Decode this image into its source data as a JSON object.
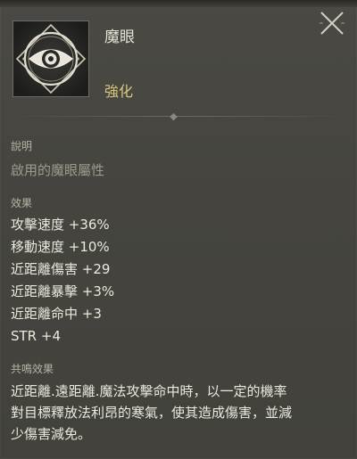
{
  "item": {
    "name": "魔眼",
    "category": "強化",
    "icon": "eye-sigil-icon"
  },
  "close_icon": "close-icon",
  "description_section": {
    "label": "說明",
    "text": "啟用的魔眼屬性"
  },
  "effects_section": {
    "label": "效果",
    "lines": [
      "攻擊速度 +36%",
      "移動速度 +10%",
      "近距離傷害 +29",
      "近距離暴擊 +3%",
      "近距離命中 +3",
      "STR +4"
    ]
  },
  "resonance_section": {
    "label": "共鳴效果",
    "lines": [
      "近距離.遠距離.魔法攻擊命中時，以一定的機率",
      "對目標釋放法利昂的寒氣，使其造成傷害，並減",
      "少傷害減免。"
    ]
  },
  "colors": {
    "name_text": "#e7e2d6",
    "category_text": "#d8c77f",
    "label_text": "#b7b2a5",
    "description_text": "#9f9a8e",
    "body_text": "#ece8dd",
    "panel_bg": "#45443f"
  }
}
